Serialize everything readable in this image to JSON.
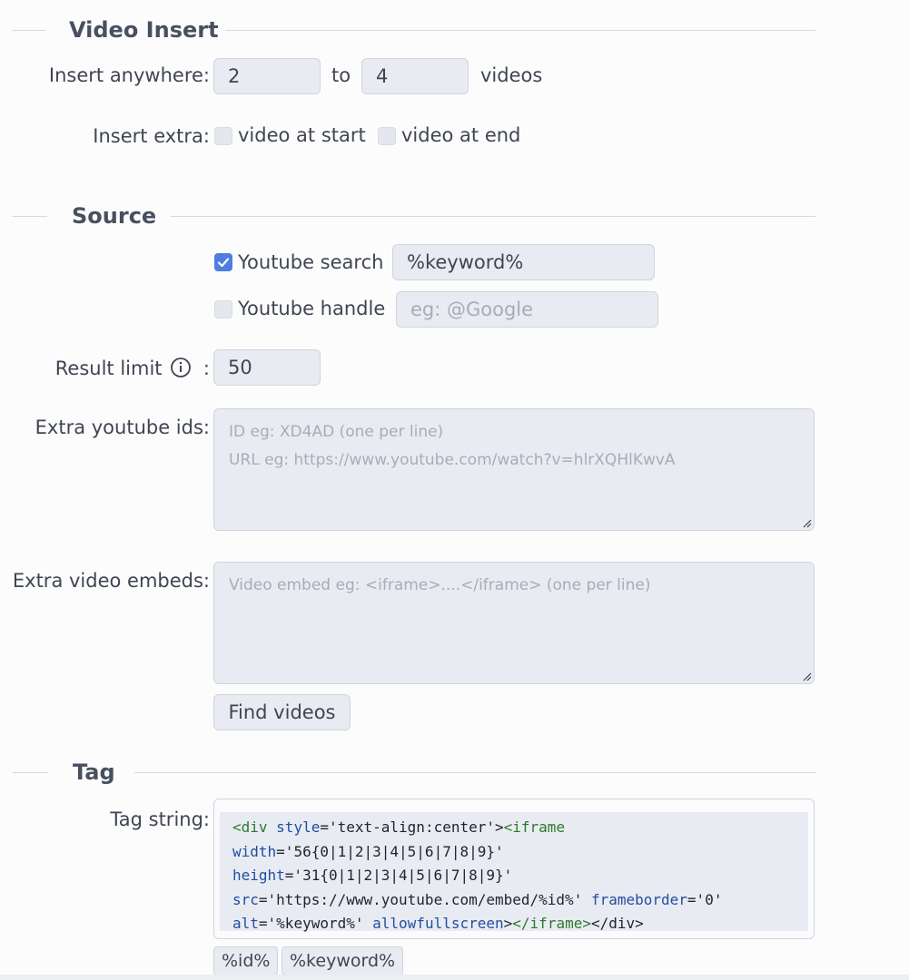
{
  "video_insert": {
    "title": "Video Insert",
    "insert_anywhere_label": "Insert anywhere",
    "min_value": "2",
    "to_label": "to",
    "max_value": "4",
    "videos_label": "videos",
    "insert_extra_label": "Insert extra",
    "video_at_start_label": "video at start",
    "video_at_start_checked": false,
    "video_at_end_label": "video at end",
    "video_at_end_checked": false
  },
  "source": {
    "title": "Source",
    "youtube_search_label": "Youtube search",
    "youtube_search_checked": true,
    "youtube_search_value": "%keyword%",
    "youtube_handle_label": "Youtube handle",
    "youtube_handle_checked": false,
    "youtube_handle_placeholder": "eg: @Google",
    "result_limit_label": "Result limit",
    "result_limit_value": "50",
    "extra_ids_label": "Extra youtube ids",
    "extra_ids_placeholder_line1": "ID eg: XD4AD (one per line)",
    "extra_ids_placeholder_line2": "URL eg: https://www.youtube.com/watch?v=hlrXQHlKwvA",
    "extra_embeds_label": "Extra video embeds",
    "extra_embeds_placeholder": "Video embed eg: <iframe>....</iframe> (one per line)",
    "find_videos_label": "Find videos"
  },
  "tag": {
    "title": "Tag",
    "tag_string_label": "Tag string",
    "code_lines": [
      [
        [
          "kw",
          "<div "
        ],
        [
          "attr",
          "style"
        ],
        [
          "str",
          "='text-align:center'>"
        ],
        [
          "kw",
          "<iframe"
        ]
      ],
      [
        [
          "attr",
          "width"
        ],
        [
          "str",
          "='56{0|1|2|3|4|5|6|7|8|9}'"
        ]
      ],
      [
        [
          "attr",
          "height"
        ],
        [
          "str",
          "='31{0|1|2|3|4|5|6|7|8|9}'"
        ]
      ],
      [
        [
          "attr",
          "src"
        ],
        [
          "str",
          "='https://www.youtube.com/embed/%id%' "
        ],
        [
          "attr",
          "frameborder"
        ],
        [
          "str",
          "='0'"
        ]
      ],
      [
        [
          "attr",
          "alt"
        ],
        [
          "str",
          "='%keyword%' "
        ],
        [
          "attr",
          "allowfullscreen"
        ],
        [
          "str",
          ">"
        ],
        [
          "kw",
          "</iframe>"
        ],
        [
          "str",
          "</div>"
        ]
      ]
    ],
    "chips": [
      "%id%",
      "%keyword%"
    ]
  },
  "colon": ":"
}
